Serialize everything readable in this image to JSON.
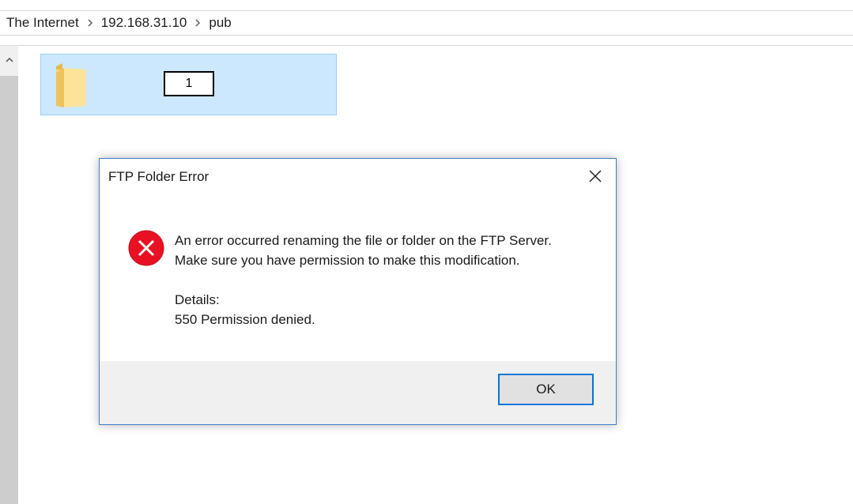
{
  "breadcrumb": {
    "items": [
      "The Internet",
      "192.168.31.10",
      "pub"
    ]
  },
  "folder": {
    "rename_value": "1",
    "icon": "folder-icon"
  },
  "dialog": {
    "title": "FTP Folder Error",
    "message_line1": "An error occurred renaming the file or folder on the FTP Server.",
    "message_line2": "Make sure you have permission to make this modification.",
    "details_label": "Details:",
    "details_text": "550 Permission denied.",
    "ok_label": "OK",
    "icon": "error-icon"
  },
  "colors": {
    "selection_fill": "#cce8ff",
    "selection_border": "#99d1ff",
    "error_red": "#e81123",
    "accent_blue": "#0078d7"
  }
}
